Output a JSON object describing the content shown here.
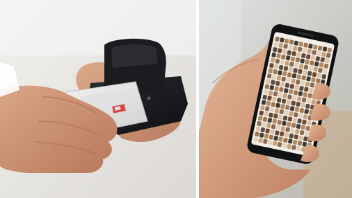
{
  "photo": {
    "left_panel": {
      "subject": "hands-holding-card-reader",
      "colors": {
        "background": "#e9e7e3",
        "skin": "#c98f6f",
        "device": "#1e1f22",
        "card": "#e7e7e7",
        "card_accent": "#d44a4a"
      }
    },
    "right_panel": {
      "subject": "hand-holding-smartphone",
      "colors": {
        "background": "#cdd3cf",
        "skin": "#d6a283",
        "phone": "#101214",
        "screen": "#f3efe8"
      },
      "grid": {
        "columns": 12,
        "rows": 20
      }
    }
  }
}
